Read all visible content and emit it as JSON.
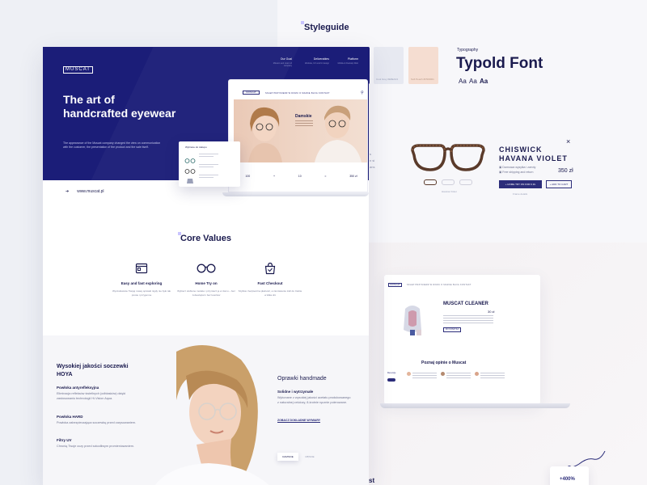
{
  "styleguide": {
    "title": "Styleguide",
    "swatches": [
      {
        "label": "Dark Blue #1B1D78",
        "color": "#1b1d78"
      },
      {
        "label": "Cool Grey #E8EAF2",
        "color": "#e7e9f1"
      },
      {
        "label": "Soft Peach #F5DDD1",
        "color": "#f5ddd1"
      }
    ],
    "typography_label": "Typography",
    "font_name": "Typold Font",
    "samples": [
      "Aa",
      "Aa",
      "Aa"
    ]
  },
  "product": {
    "name_line1": "CHISWICK",
    "name_line2": "HAVANA VIOLET",
    "close": "×",
    "features": [
      "Darmowa wysyłka i zwroty",
      "Free shipping and return"
    ],
    "price": "350 zł",
    "try_button": "+ HOME TRY ON FOR 0 ZŁ",
    "cart_button": "+ ADD TO CART",
    "link": "Frame details",
    "thumb_caption": "Havana Violet",
    "stray_text": [
      "s",
      "n si",
      "ans"
    ]
  },
  "laptop2": {
    "logo": "MUSCAT",
    "nav": "SKLEP   PRZYMIERZ W DOMU   O MARCE   BLOG   KONTAKT",
    "product_name": "MUSCAT CLEANER",
    "price": "30 zł",
    "button": "DO KOSZYKA",
    "reviews_title": "Poznaj opinie o Muscat",
    "badge": "Recenzje"
  },
  "stats": {
    "value": "+400%"
  },
  "stray_bottom": "st",
  "colors": {
    "brand": "#1b1d78",
    "accent": "#2c2d7a",
    "peach": "#eac9b6"
  },
  "hero": {
    "logo": "MUSCAT",
    "nav": [
      {
        "label": "Our Goal",
        "sub": "Mission and vision of company"
      },
      {
        "label": "Deliverables",
        "sub": "Website, UX and UI design"
      },
      {
        "label": "Platform",
        "sub": "Mobile & Desktop Web"
      }
    ],
    "headline": "The art of handcrafted eyewear",
    "description": "The appearance of the Muscat company changed the view on communication with the customer, the presentation of the product and the sale itself.",
    "url": "www.muscat.pl"
  },
  "laptop1": {
    "logo": "MUSCAT",
    "nav": "SKLEP   PRZYMIERZ W DOMU   O MARCE   BLOG   KONTAKT",
    "tag": "Damskie",
    "stat1": "100",
    "stat2": "10",
    "price": "350 zł",
    "popup_title": "Wybrane do zakupu"
  },
  "core": {
    "title": "Core Values",
    "items": [
      {
        "title": "Easy and fast exploring",
        "desc": "Wyszukiwanie Twojej nowej oprawki nigdy nie było tak proste i przyjemne"
      },
      {
        "title": "Home Try on",
        "desc": "Wybierz ulubione modele i przymierz je w domu – bez zobowiązań i bez kosztów"
      },
      {
        "title": "Fast Checkout",
        "desc": "Szybka i bezpieczna płatność, a zamówienie trafi do Ciebie w kilka dni"
      }
    ]
  },
  "lenses": {
    "title": "Wysokiej jakości soczewki HOYA",
    "features": [
      {
        "title": "Powłoka antyrefleksyjna",
        "desc": "Eliminacja refleksów świetlnych (odblasków) dzięki zastosowaniu technologii Hi-Vision Aqua."
      },
      {
        "title": "Powłoka HARD",
        "desc": "Powłoka zabezpieczająca soczewkę przed zarysowaniem."
      },
      {
        "title": "Filtry UV",
        "desc": "Chronią Twoje oczy przed szkodliwym promieniowaniem."
      }
    ]
  },
  "frames": {
    "title": "Oprawki handmade",
    "subtitle": "Solidne i wytrzymałe",
    "desc": "Wykonane z wysokiej jakości acetatu produkowanego z naturalnej celulozy, 8-krotnie ręcznie polerowane.",
    "link": "ZOBACZ DOKŁADNE WYMIARY",
    "tab_on": "DAMSKIE",
    "tab_off": "MĘSKIE"
  }
}
